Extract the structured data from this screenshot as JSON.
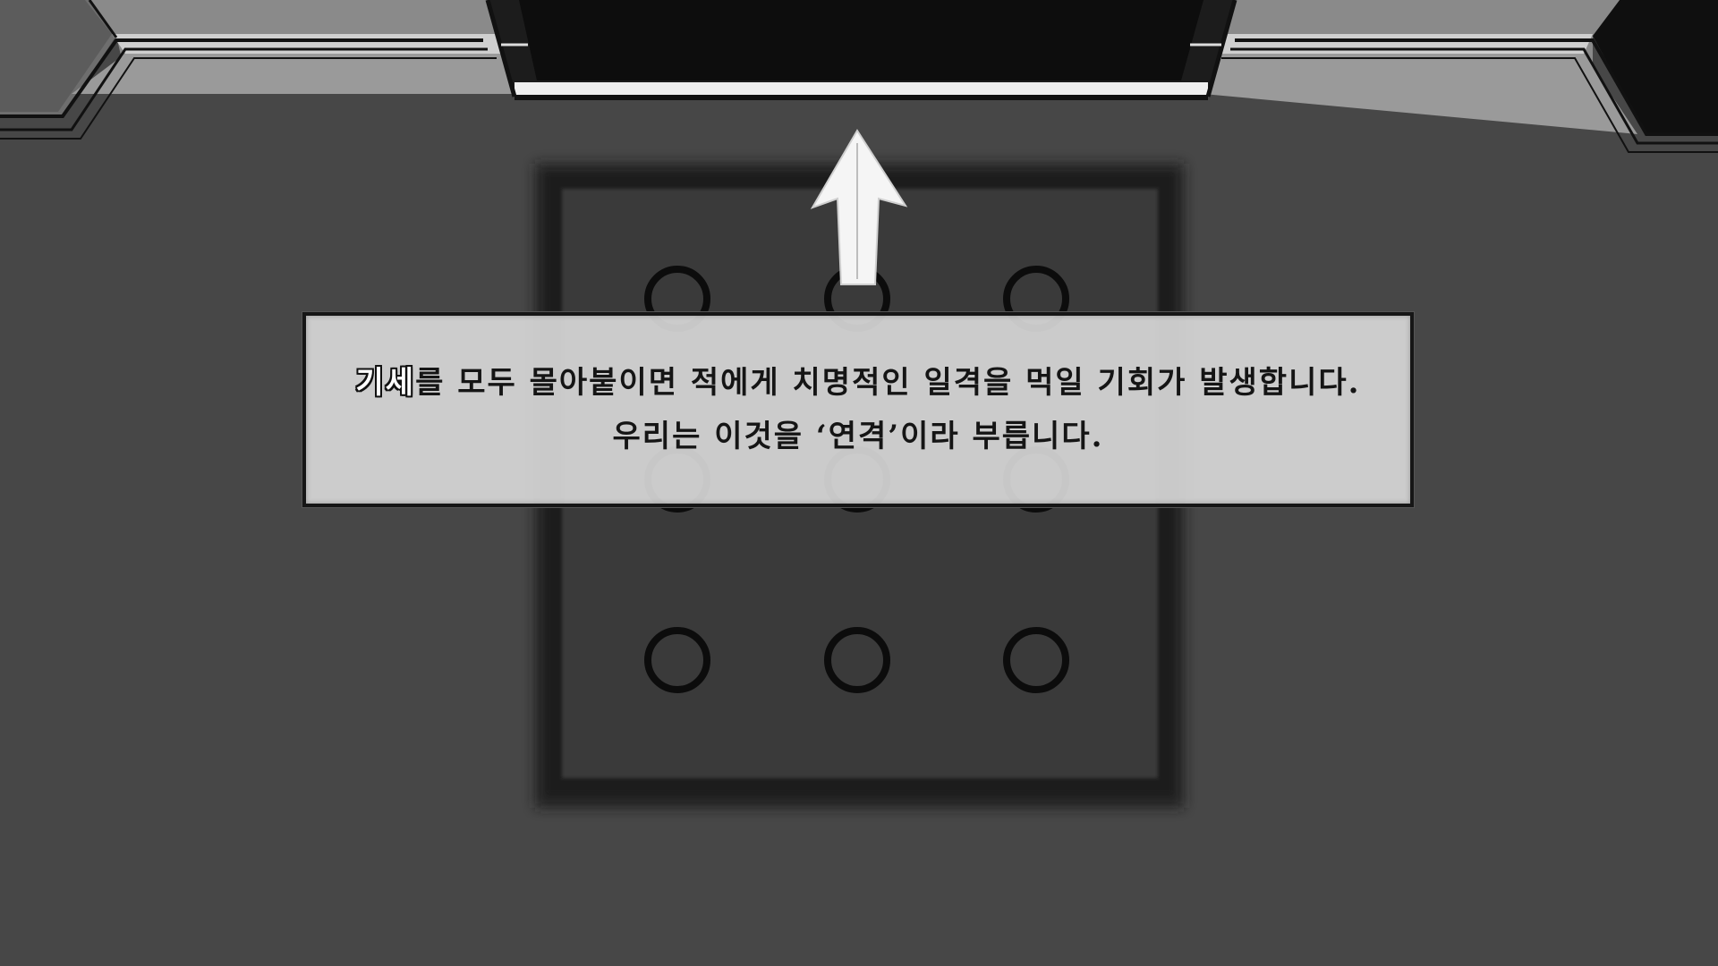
{
  "tutorial": {
    "line1_keyword": "기세",
    "line1_rest": "를 모두 몰아붙이면 적에게 치명적인 일격을 먹일 기회가 발생합니다.",
    "line2": "우리는 이것을 ‘연격’이라 부릅니다."
  },
  "direction_hint": "up-arrow-icon",
  "grid": {
    "rows": 3,
    "cols": 3
  },
  "colors": {
    "background": "#474747",
    "panel": "#3b3b3b",
    "dialog": "#d6d6d6",
    "ink": "#151515",
    "arrow": "#f5f5f5"
  }
}
